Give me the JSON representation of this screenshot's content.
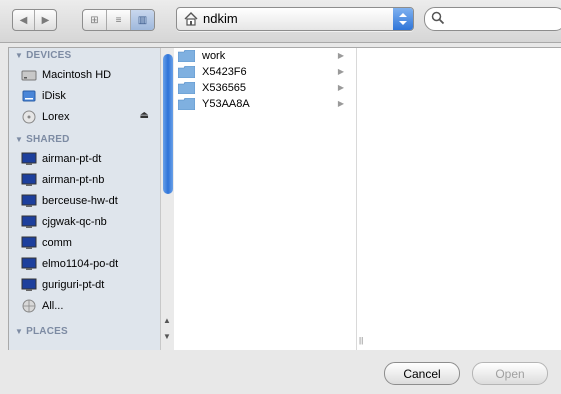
{
  "toolbar": {
    "nav_back_icon": "back-arrow",
    "nav_forward_icon": "forward-arrow",
    "view_modes": [
      "icon-view",
      "list-view",
      "column-view"
    ],
    "active_view": "column-view",
    "path": "ndkim",
    "search_placeholder": ""
  },
  "sidebar": {
    "sections": [
      {
        "title": "DEVICES",
        "items": [
          {
            "label": "Macintosh HD",
            "icon": "harddisk-icon"
          },
          {
            "label": "iDisk",
            "icon": "idisk-icon"
          },
          {
            "label": "Lorex",
            "icon": "disc-icon",
            "eject": true
          }
        ]
      },
      {
        "title": "SHARED",
        "items": [
          {
            "label": "airman-pt-dt",
            "icon": "computer-icon"
          },
          {
            "label": "airman-pt-nb",
            "icon": "computer-icon"
          },
          {
            "label": "berceuse-hw-dt",
            "icon": "computer-icon"
          },
          {
            "label": "cjgwak-qc-nb",
            "icon": "computer-icon"
          },
          {
            "label": "comm",
            "icon": "computer-icon"
          },
          {
            "label": "elmo1104-po-dt",
            "icon": "computer-icon"
          },
          {
            "label": "guriguri-pt-dt",
            "icon": "computer-icon"
          },
          {
            "label": "All...",
            "icon": "network-globe-icon"
          }
        ]
      },
      {
        "title": "PLACES",
        "items": []
      }
    ]
  },
  "browser": {
    "column1": [
      {
        "name": "work"
      },
      {
        "name": "X5423F6"
      },
      {
        "name": "X536565"
      },
      {
        "name": "Y53AA8A"
      }
    ]
  },
  "buttons": {
    "cancel": "Cancel",
    "open": "Open"
  },
  "colors": {
    "accent_blue": "#2f74d8",
    "sidebar_bg": "#dfe5ec",
    "section_header": "#7d8ba3"
  }
}
